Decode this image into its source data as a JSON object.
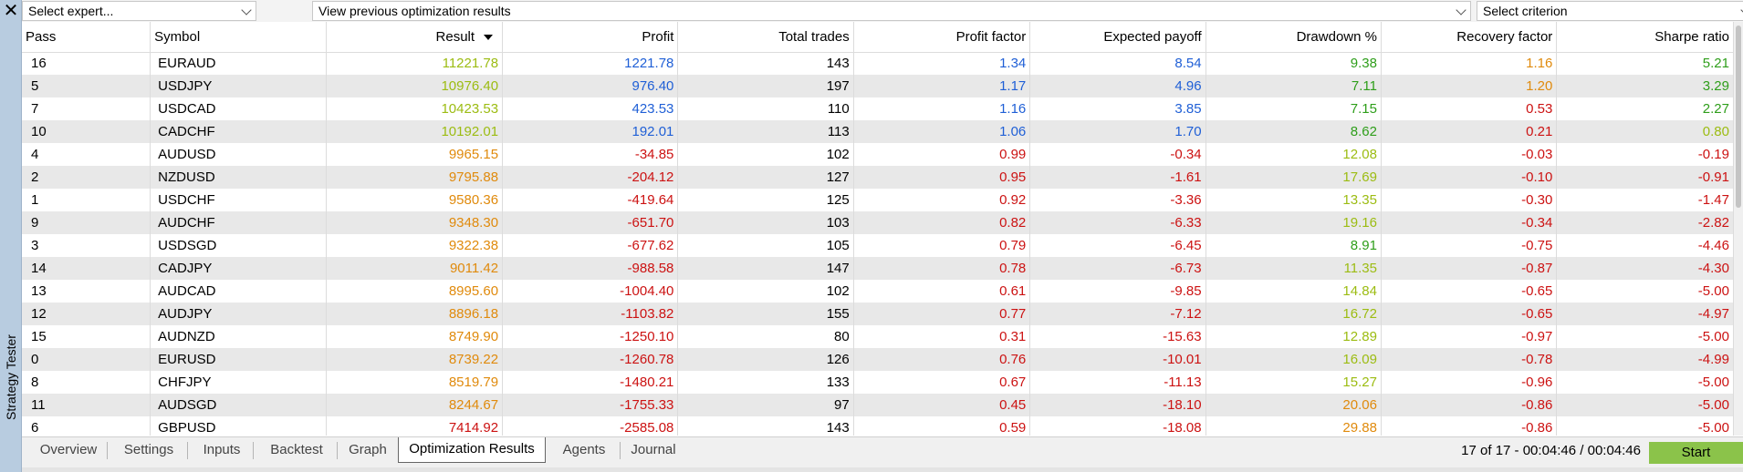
{
  "panel": {
    "close_glyph": "✕",
    "title": "Strategy Tester"
  },
  "topbar": {
    "expert_select": "Select expert...",
    "results_select": "View previous optimization results",
    "criterion_select": "Select criterion"
  },
  "table": {
    "columns": [
      "Pass",
      "Symbol",
      "Result",
      "Profit",
      "Total trades",
      "Profit factor",
      "Expected payoff",
      "Drawdown %",
      "Recovery factor",
      "Sharpe ratio"
    ],
    "sorted_column": "Result",
    "sort_direction": "descending",
    "rows": [
      {
        "pass": "16",
        "symbol": "EURAUD",
        "result": "11221.78",
        "profit": "1221.78",
        "trades": "143",
        "pf": "1.34",
        "payoff": "8.54",
        "dd": "9.38",
        "recovery": "1.16",
        "sharpe": "5.21"
      },
      {
        "pass": "5",
        "symbol": "USDJPY",
        "result": "10976.40",
        "profit": "976.40",
        "trades": "197",
        "pf": "1.17",
        "payoff": "4.96",
        "dd": "7.11",
        "recovery": "1.20",
        "sharpe": "3.29"
      },
      {
        "pass": "7",
        "symbol": "USDCAD",
        "result": "10423.53",
        "profit": "423.53",
        "trades": "110",
        "pf": "1.16",
        "payoff": "3.85",
        "dd": "7.15",
        "recovery": "0.53",
        "sharpe": "2.27"
      },
      {
        "pass": "10",
        "symbol": "CADCHF",
        "result": "10192.01",
        "profit": "192.01",
        "trades": "113",
        "pf": "1.06",
        "payoff": "1.70",
        "dd": "8.62",
        "recovery": "0.21",
        "sharpe": "0.80"
      },
      {
        "pass": "4",
        "symbol": "AUDUSD",
        "result": "9965.15",
        "profit": "-34.85",
        "trades": "102",
        "pf": "0.99",
        "payoff": "-0.34",
        "dd": "12.08",
        "recovery": "-0.03",
        "sharpe": "-0.19"
      },
      {
        "pass": "2",
        "symbol": "NZDUSD",
        "result": "9795.88",
        "profit": "-204.12",
        "trades": "127",
        "pf": "0.95",
        "payoff": "-1.61",
        "dd": "17.69",
        "recovery": "-0.10",
        "sharpe": "-0.91"
      },
      {
        "pass": "1",
        "symbol": "USDCHF",
        "result": "9580.36",
        "profit": "-419.64",
        "trades": "125",
        "pf": "0.92",
        "payoff": "-3.36",
        "dd": "13.35",
        "recovery": "-0.30",
        "sharpe": "-1.47"
      },
      {
        "pass": "9",
        "symbol": "AUDCHF",
        "result": "9348.30",
        "profit": "-651.70",
        "trades": "103",
        "pf": "0.82",
        "payoff": "-6.33",
        "dd": "19.16",
        "recovery": "-0.34",
        "sharpe": "-2.82"
      },
      {
        "pass": "3",
        "symbol": "USDSGD",
        "result": "9322.38",
        "profit": "-677.62",
        "trades": "105",
        "pf": "0.79",
        "payoff": "-6.45",
        "dd": "8.91",
        "recovery": "-0.75",
        "sharpe": "-4.46"
      },
      {
        "pass": "14",
        "symbol": "CADJPY",
        "result": "9011.42",
        "profit": "-988.58",
        "trades": "147",
        "pf": "0.78",
        "payoff": "-6.73",
        "dd": "11.35",
        "recovery": "-0.87",
        "sharpe": "-4.30"
      },
      {
        "pass": "13",
        "symbol": "AUDCAD",
        "result": "8995.60",
        "profit": "-1004.40",
        "trades": "102",
        "pf": "0.61",
        "payoff": "-9.85",
        "dd": "14.84",
        "recovery": "-0.65",
        "sharpe": "-5.00"
      },
      {
        "pass": "12",
        "symbol": "AUDJPY",
        "result": "8896.18",
        "profit": "-1103.82",
        "trades": "155",
        "pf": "0.77",
        "payoff": "-7.12",
        "dd": "16.72",
        "recovery": "-0.65",
        "sharpe": "-4.97"
      },
      {
        "pass": "15",
        "symbol": "AUDNZD",
        "result": "8749.90",
        "profit": "-1250.10",
        "trades": "80",
        "pf": "0.31",
        "payoff": "-15.63",
        "dd": "12.89",
        "recovery": "-0.97",
        "sharpe": "-5.00"
      },
      {
        "pass": "0",
        "symbol": "EURUSD",
        "result": "8739.22",
        "profit": "-1260.78",
        "trades": "126",
        "pf": "0.76",
        "payoff": "-10.01",
        "dd": "16.09",
        "recovery": "-0.78",
        "sharpe": "-4.99"
      },
      {
        "pass": "8",
        "symbol": "CHFJPY",
        "result": "8519.79",
        "profit": "-1480.21",
        "trades": "133",
        "pf": "0.67",
        "payoff": "-11.13",
        "dd": "15.27",
        "recovery": "-0.96",
        "sharpe": "-5.00"
      },
      {
        "pass": "11",
        "symbol": "AUDSGD",
        "result": "8244.67",
        "profit": "-1755.33",
        "trades": "97",
        "pf": "0.45",
        "payoff": "-18.10",
        "dd": "20.06",
        "recovery": "-0.86",
        "sharpe": "-5.00"
      },
      {
        "pass": "6",
        "symbol": "GBPUSD",
        "result": "7414.92",
        "profit": "-2585.08",
        "trades": "143",
        "pf": "0.59",
        "payoff": "-18.08",
        "dd": "29.88",
        "recovery": "-0.86",
        "sharpe": "-5.00"
      }
    ]
  },
  "colors": {
    "positive_blue": "#1f5fd6",
    "negative_red": "#cc1212",
    "green": "#2e9e1a",
    "yellow_green": "#9cbc12",
    "orange": "#e08a0c",
    "start_button": "#8bc34a"
  },
  "tabs": [
    "Overview",
    "Settings",
    "Inputs",
    "Backtest",
    "Graph",
    "Optimization Results",
    "Agents",
    "Journal"
  ],
  "active_tab": "Optimization Results",
  "status": {
    "progress_text": "17 of 17  -  00:04:46 / 00:04:46",
    "start_label": "Start"
  }
}
